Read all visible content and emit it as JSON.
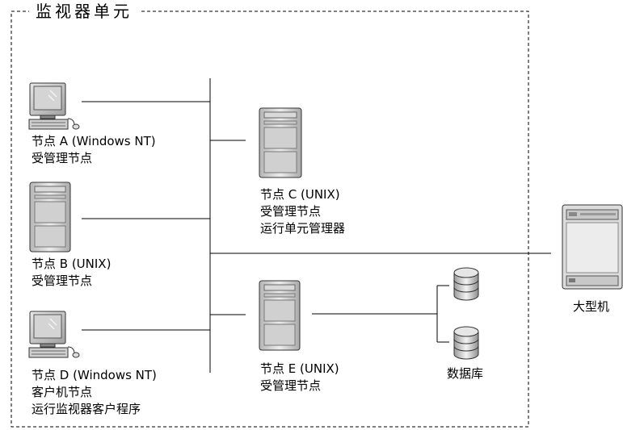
{
  "unit_title": "监视器单元",
  "nodes": {
    "node_a": {
      "name": "节点 A (Windows NT)",
      "role": "受管理节点"
    },
    "node_b": {
      "name": "节点 B (UNIX)",
      "role": "受管理节点"
    },
    "node_c": {
      "name": "节点 C (UNIX)",
      "role": "受管理节点",
      "extra": "运行单元管理器"
    },
    "node_d": {
      "name": "节点 D (Windows NT)",
      "role": "客户机节点",
      "extra": "运行监视器客户程序"
    },
    "node_e": {
      "name": "节点 E (UNIX)",
      "role": "受管理节点"
    }
  },
  "database_label": "数据库",
  "mainframe_label": "大型机"
}
